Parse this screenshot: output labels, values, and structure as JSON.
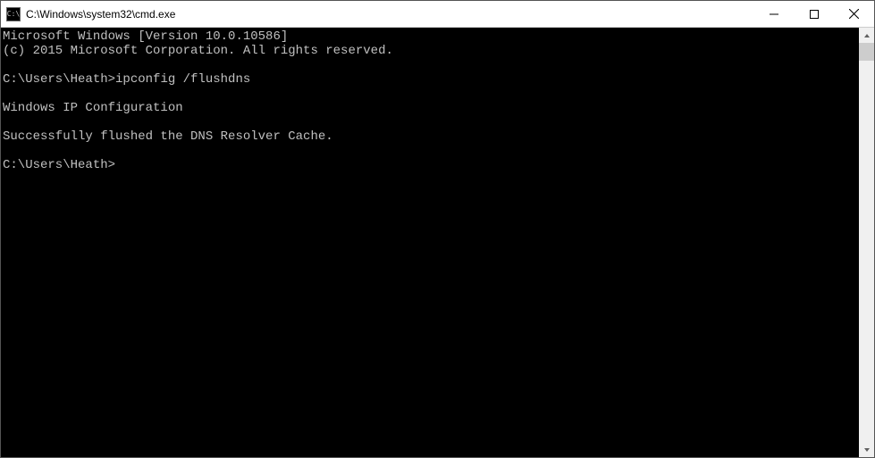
{
  "titlebar": {
    "icon_label": "C:\\",
    "title": "C:\\Windows\\system32\\cmd.exe",
    "minimize_label": "Minimize",
    "maximize_label": "Maximize",
    "close_label": "Close"
  },
  "terminal": {
    "line1": "Microsoft Windows [Version 10.0.10586]",
    "line2": "(c) 2015 Microsoft Corporation. All rights reserved.",
    "blank1": "",
    "prompt1_prefix": "C:\\Users\\Heath>",
    "prompt1_command": "ipconfig /flushdns",
    "blank2": "",
    "output_header": "Windows IP Configuration",
    "blank3": "",
    "output_result": "Successfully flushed the DNS Resolver Cache.",
    "blank4": "",
    "prompt2_prefix": "C:\\Users\\Heath>"
  }
}
